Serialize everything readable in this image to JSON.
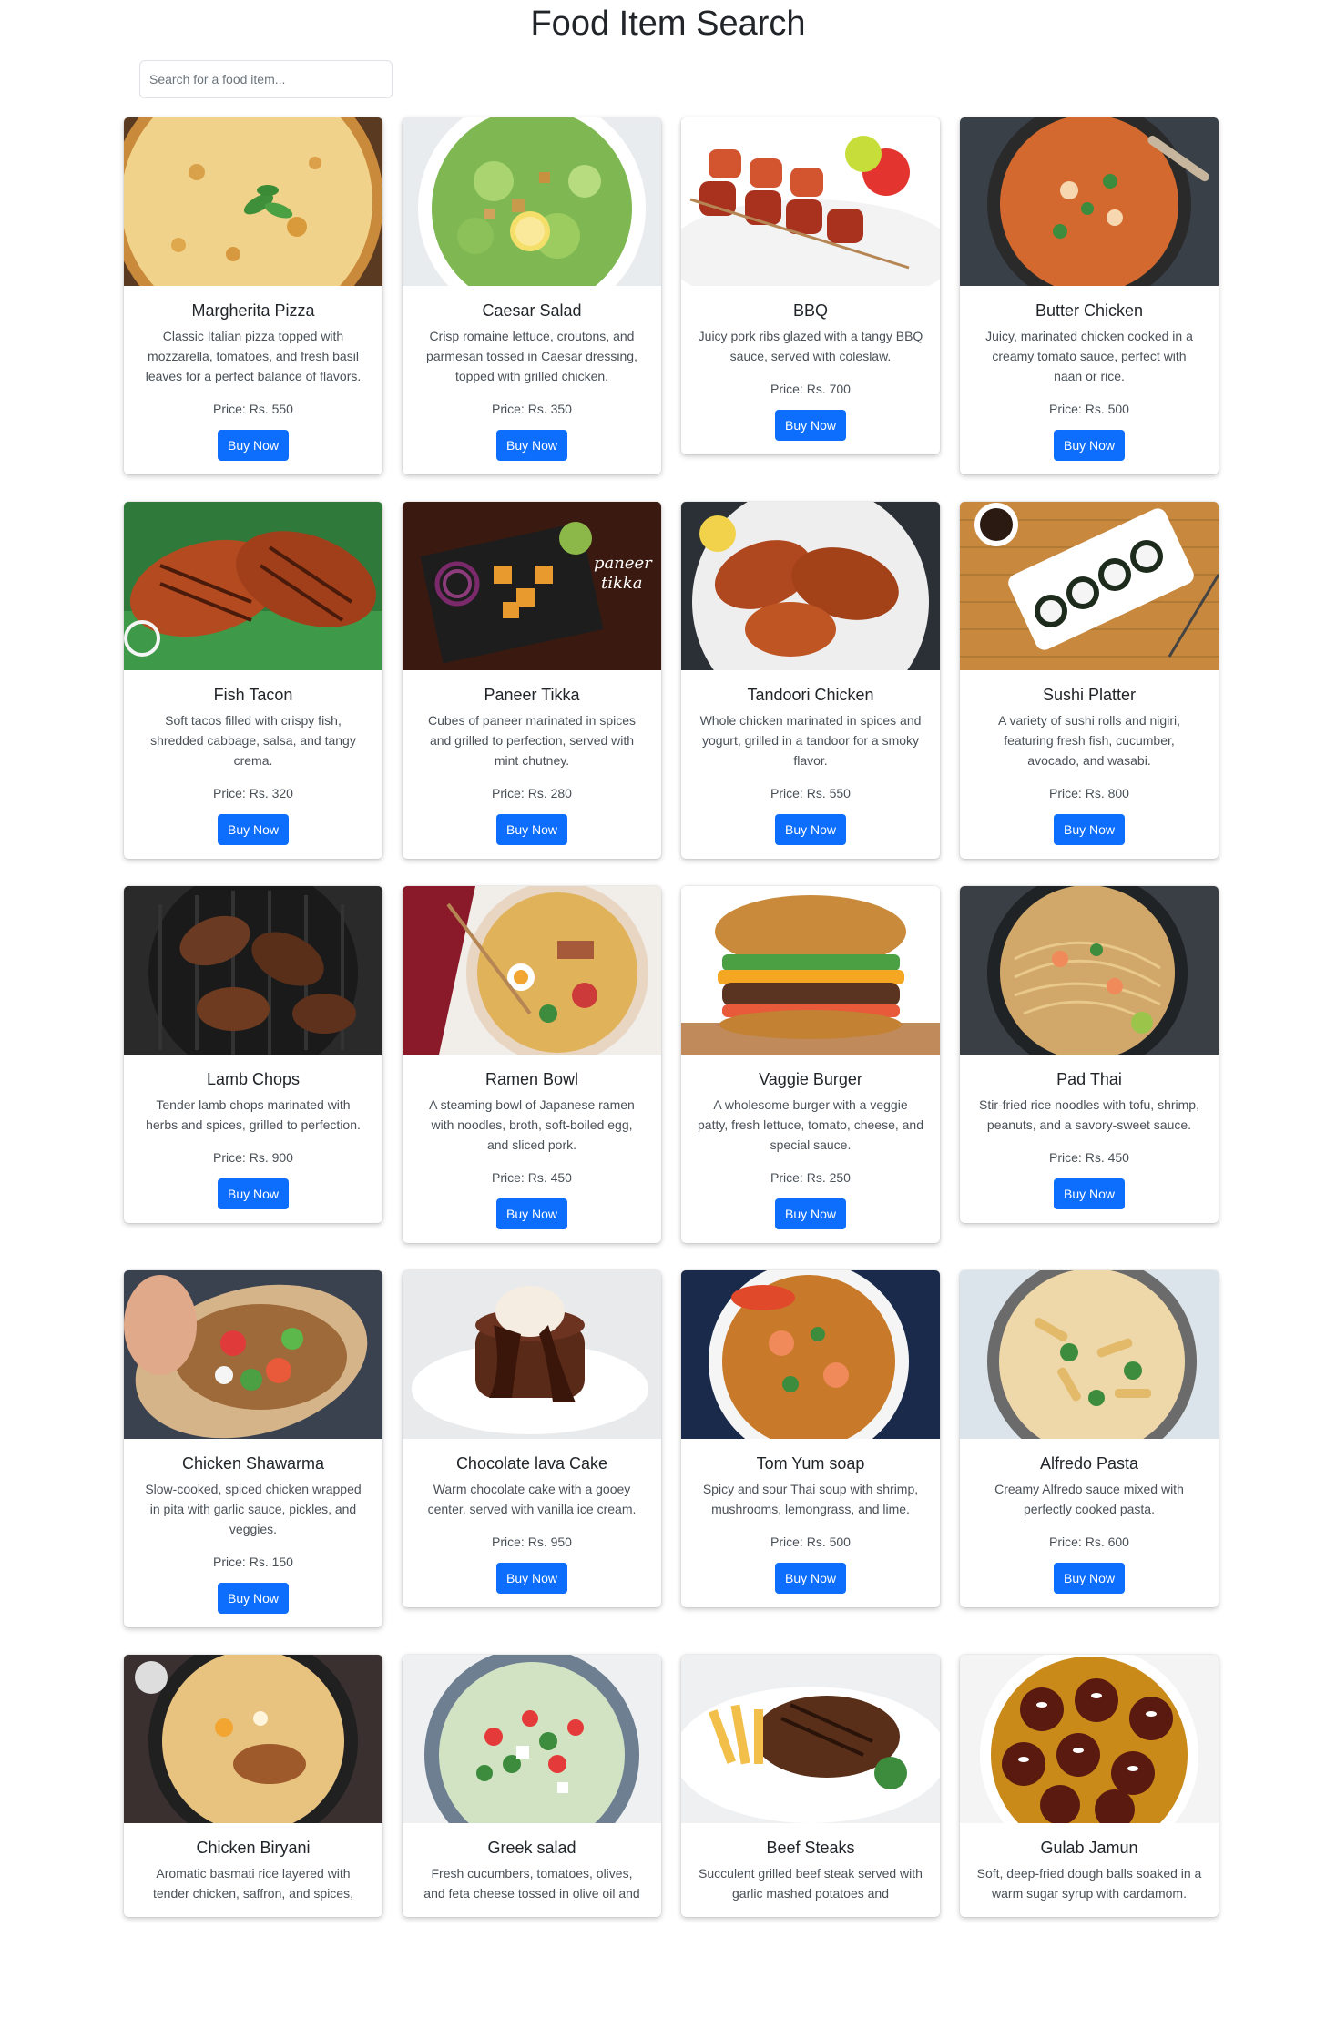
{
  "page": {
    "title": "Food Item Search",
    "search_placeholder": "Search for a food item..."
  },
  "colors": {
    "button": "#0d6efd",
    "button_text": "#ffffff",
    "background": "#ffffff"
  },
  "items": [
    {
      "name": "Margherita Pizza",
      "description": "Classic Italian pizza topped with mozzarella, tomatoes, and fresh basil leaves for a perfect balance of flavors.",
      "price": "Price: Rs. 550",
      "button": "Buy Now",
      "image": "pizza"
    },
    {
      "name": "Caesar Salad",
      "description": "Crisp romaine lettuce, croutons, and parmesan tossed in Caesar dressing, topped with grilled chicken.",
      "price": "Price: Rs. 350",
      "button": "Buy Now",
      "image": "salad"
    },
    {
      "name": "BBQ",
      "description": "Juicy pork ribs glazed with a tangy BBQ sauce, served with coleslaw.",
      "price": "Price: Rs. 700",
      "button": "Buy Now",
      "image": "skewers"
    },
    {
      "name": "Butter Chicken",
      "description": "Juicy, marinated chicken cooked in a creamy tomato sauce, perfect with naan or rice.",
      "price": "Price: Rs. 500",
      "button": "Buy Now",
      "image": "curry"
    },
    {
      "name": "Fish Tacon",
      "description": "Soft tacos filled with crispy fish, shredded cabbage, salsa, and tangy crema.",
      "price": "Price: Rs. 320",
      "button": "Buy Now",
      "image": "fish"
    },
    {
      "name": "Paneer Tikka",
      "description": "Cubes of paneer marinated in spices and grilled to perfection, served with mint chutney.",
      "price": "Price: Rs. 280",
      "button": "Buy Now",
      "image": "paneer",
      "image_text": [
        "paneer",
        "tikka"
      ]
    },
    {
      "name": "Tandoori Chicken",
      "description": "Whole chicken marinated in spices and yogurt, grilled in a tandoor for a smoky flavor.",
      "price": "Price: Rs. 550",
      "button": "Buy Now",
      "image": "tandoori"
    },
    {
      "name": "Sushi Platter",
      "description": "A variety of sushi rolls and nigiri, featuring fresh fish, cucumber, avocado, and wasabi.",
      "price": "Price: Rs. 800",
      "button": "Buy Now",
      "image": "sushi"
    },
    {
      "name": "Lamb Chops",
      "description": "Tender lamb chops marinated with herbs and spices, grilled to perfection.",
      "price": "Price: Rs. 900",
      "button": "Buy Now",
      "image": "lamb"
    },
    {
      "name": "Ramen Bowl",
      "description": "A steaming bowl of Japanese ramen with noodles, broth, soft-boiled egg, and sliced pork.",
      "price": "Price: Rs. 450",
      "button": "Buy Now",
      "image": "ramen"
    },
    {
      "name": "Vaggie Burger",
      "description": "A wholesome burger with a veggie patty, fresh lettuce, tomato, cheese, and special sauce.",
      "price": "Price: Rs. 250",
      "button": "Buy Now",
      "image": "burger"
    },
    {
      "name": "Pad Thai",
      "description": "Stir-fried rice noodles with tofu, shrimp, peanuts, and a savory-sweet sauce.",
      "price": "Price: Rs. 450",
      "button": "Buy Now",
      "image": "padthai"
    },
    {
      "name": "Chicken Shawarma",
      "description": "Slow-cooked, spiced chicken wrapped in pita with garlic sauce, pickles, and veggies.",
      "price": "Price: Rs. 150",
      "button": "Buy Now",
      "image": "shawarma"
    },
    {
      "name": "Chocolate lava Cake",
      "description": "Warm chocolate cake with a gooey center, served with vanilla ice cream.",
      "price": "Price: Rs. 950",
      "button": "Buy Now",
      "image": "lava"
    },
    {
      "name": "Tom Yum soap",
      "description": "Spicy and sour Thai soup with shrimp, mushrooms, lemongrass, and lime.",
      "price": "Price: Rs. 500",
      "button": "Buy Now",
      "image": "tomyum"
    },
    {
      "name": "Alfredo Pasta",
      "description": "Creamy Alfredo sauce mixed with perfectly cooked pasta.",
      "price": "Price: Rs. 600",
      "button": "Buy Now",
      "image": "pasta"
    },
    {
      "name": "Chicken Biryani",
      "description": "Aromatic basmati rice layered with tender chicken, saffron, and spices,",
      "price": "",
      "button": "",
      "image": "biryani"
    },
    {
      "name": "Greek salad",
      "description": "Fresh cucumbers, tomatoes, olives, and feta cheese tossed in olive oil and",
      "price": "",
      "button": "",
      "image": "greek"
    },
    {
      "name": "Beef Steaks",
      "description": "Succulent grilled beef steak served with garlic mashed potatoes and",
      "price": "",
      "button": "",
      "image": "steak"
    },
    {
      "name": "Gulab Jamun",
      "description": "Soft, deep-fried dough balls soaked in a warm sugar syrup with cardamom.",
      "price": "",
      "button": "",
      "image": "gulab"
    }
  ]
}
